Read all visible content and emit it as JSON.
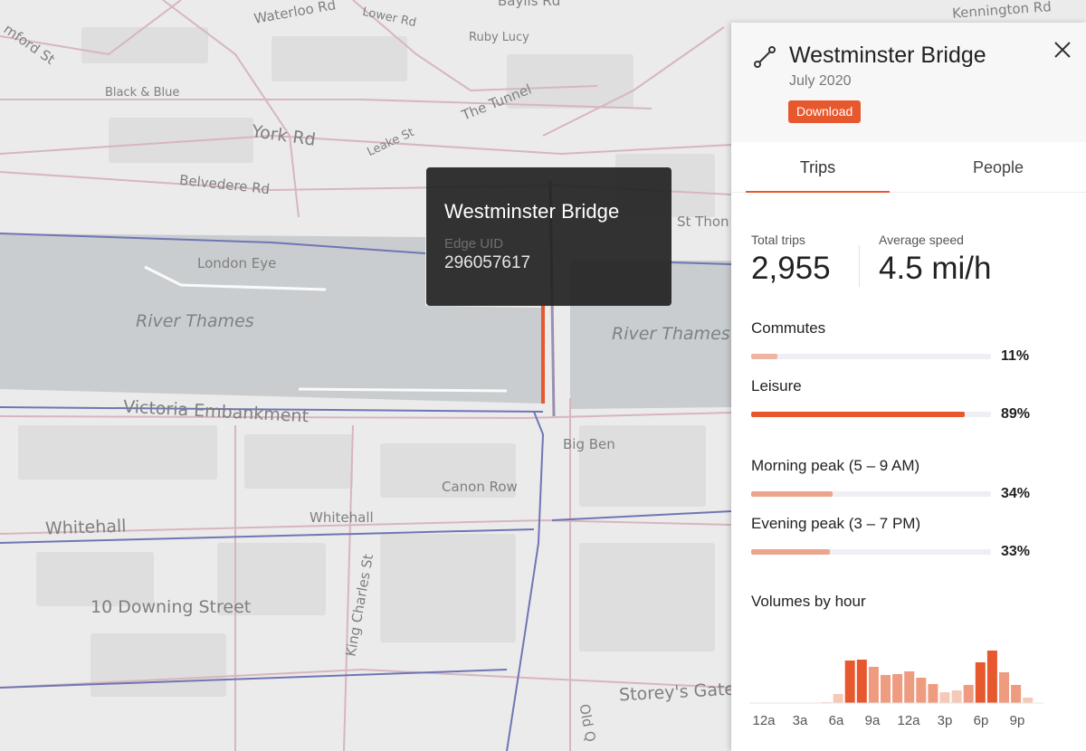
{
  "map": {
    "labels": {
      "waterloo_rd": "Waterloo Rd",
      "lower_rd": "Lower Rd",
      "baylis_rd": "Baylis Rd",
      "kennington_rd": "Kennington Rd",
      "stamford_st": "mford St",
      "ruby_lucy": "Ruby Lucy",
      "black_blue": "Black & Blue",
      "the_tunnel": "The Tunnel",
      "york_rd": "York Rd",
      "leake_st": "Leake St",
      "belvedere_rd": "Belvedere Rd",
      "st_thomas": "St Thon",
      "london_eye": "London Eye",
      "river_thames_left": "River Thames",
      "river_thames_right": "River Thames",
      "victoria_embankment": "Victoria Embankment",
      "big_ben": "Big Ben",
      "canon_row": "Canon Row",
      "whitehall_big": "Whitehall",
      "whitehall_small": "Whitehall",
      "king_charles_st": "King Charles St",
      "downing_street": "10 Downing Street",
      "storeys_gate": "Storey's Gate",
      "old_q": "Old Q"
    }
  },
  "tooltip": {
    "title": "Westminster Bridge",
    "edge_label": "Edge UID",
    "edge_value": "296057617"
  },
  "panel": {
    "title": "Westminster Bridge",
    "date": "July 2020",
    "download_label": "Download",
    "tabs": {
      "trips": "Trips",
      "people": "People"
    },
    "stats": {
      "total_trips_label": "Total trips",
      "total_trips_value": "2,955",
      "avg_speed_label": "Average speed",
      "avg_speed_value": "4.5 mi/h"
    },
    "bars": [
      {
        "label": "Commutes",
        "pct_text": "11%",
        "value": 0.11,
        "color": "#efb3a2"
      },
      {
        "label": "Leisure",
        "pct_text": "89%",
        "value": 0.89,
        "color": "#e8582e"
      },
      {
        "label": "Morning peak (5 – 9 AM)",
        "pct_text": "34%",
        "value": 0.34,
        "color": "#eba58f"
      },
      {
        "label": "Evening peak (3 – 7 PM)",
        "pct_text": "33%",
        "value": 0.33,
        "color": "#eba58f"
      }
    ],
    "histogram_title": "Volumes by hour"
  },
  "chart_data": {
    "type": "bar",
    "title": "Volumes by hour",
    "categories": [
      "0",
      "1",
      "2",
      "3",
      "4",
      "5",
      "6",
      "7",
      "8",
      "9",
      "10",
      "11",
      "12",
      "13",
      "14",
      "15",
      "16",
      "17",
      "18",
      "19",
      "20",
      "21",
      "22",
      "23"
    ],
    "values": [
      0,
      0,
      0,
      0,
      0,
      1,
      10,
      47,
      48,
      40,
      31,
      32,
      35,
      28,
      21,
      12,
      14,
      20,
      45,
      58,
      34,
      20,
      6,
      0
    ],
    "tick_labels": [
      "12a",
      "3a",
      "6a",
      "9a",
      "12a",
      "3p",
      "6p",
      "9p"
    ],
    "colors": {
      "strong": "#e8582e",
      "light": "#ef9b80",
      "faint": "#f5c9b8"
    }
  }
}
